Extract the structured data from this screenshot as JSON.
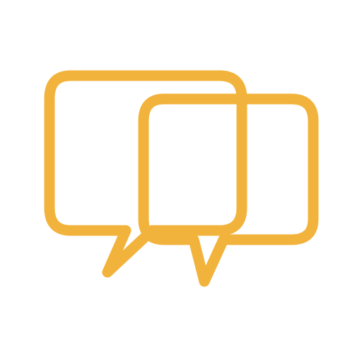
{
  "icon": {
    "name": "chat-bubbles-icon",
    "color": "#F2B33C",
    "background": "#FFFFFF"
  }
}
